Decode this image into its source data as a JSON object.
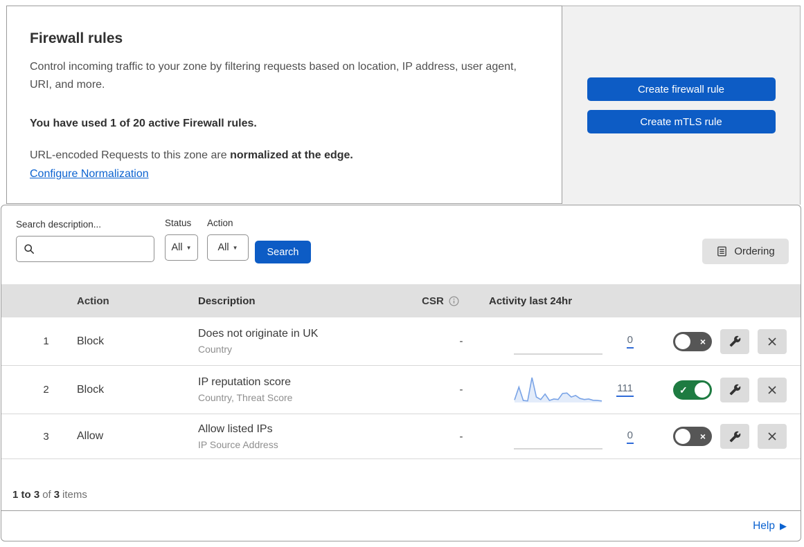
{
  "colors": {
    "primary_blue": "#0d5cc5",
    "link_blue": "#0b62d0",
    "toggle_on_green": "#1e7b41",
    "toggle_off_gray": "#565656",
    "spark_line": "#79a3e6",
    "spark_fill": "#e3ecfa",
    "spark_empty_line": "#bdbdbd"
  },
  "icons": {
    "caret_down": "▼",
    "help_arrow": "▶",
    "toggle_on_mark": "✓",
    "toggle_off_mark": "×"
  },
  "header": {
    "title": "Firewall rules",
    "description": "Control incoming traffic to your zone by filtering requests based on location, IP address, user agent, URI, and more.",
    "usage": "You have used 1 of 20 active Firewall rules.",
    "normalization_prefix": "URL-encoded Requests to this zone are ",
    "normalization_bold": "normalized at the edge.",
    "normalization_link": "Configure Normalization",
    "buttons": {
      "create_firewall_rule": "Create firewall rule",
      "create_mtls_rule": "Create mTLS rule"
    }
  },
  "filters": {
    "search_label": "Search description...",
    "search_value": "",
    "status_label": "Status",
    "status_value": "All",
    "action_label": "Action",
    "action_value": "All",
    "search_button": "Search",
    "ordering_button": "Ordering"
  },
  "table": {
    "headers": {
      "action": "Action",
      "description": "Description",
      "csr": "CSR",
      "activity": "Activity last 24hr"
    },
    "rows": [
      {
        "index": "1",
        "action": "Block",
        "description": "Does not originate in UK",
        "match_fields": "Country",
        "csr": "-",
        "activity_count": "0",
        "enabled": false,
        "activity_series": [
          0,
          0,
          0,
          0,
          0,
          0,
          0,
          0,
          0,
          0,
          0,
          0,
          0,
          0,
          0,
          0,
          0,
          0,
          0,
          0,
          0
        ]
      },
      {
        "index": "2",
        "action": "Block",
        "description": "IP reputation score",
        "match_fields": "Country, Threat Score",
        "csr": "-",
        "activity_count": "111",
        "enabled": true,
        "activity_series": [
          10,
          62,
          8,
          6,
          100,
          22,
          12,
          34,
          8,
          14,
          12,
          36,
          38,
          22,
          28,
          16,
          12,
          14,
          9,
          8,
          6
        ]
      },
      {
        "index": "3",
        "action": "Allow",
        "description": "Allow listed IPs",
        "match_fields": "IP Source Address",
        "csr": "-",
        "activity_count": "0",
        "enabled": false,
        "activity_series": [
          0,
          0,
          0,
          0,
          0,
          0,
          0,
          0,
          0,
          0,
          0,
          0,
          0,
          0,
          0,
          0,
          0,
          0,
          0,
          0,
          0
        ]
      }
    ]
  },
  "footer": {
    "range_label": "1 to 3",
    "of_label": "of",
    "total_label": "3",
    "items_label": "items",
    "help_label": "Help"
  }
}
